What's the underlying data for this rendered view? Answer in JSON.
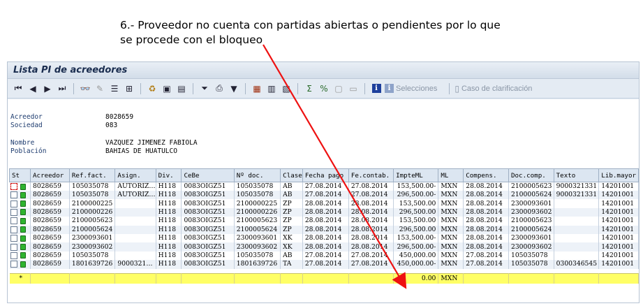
{
  "annotation": {
    "line1": "6.- Proveedor no cuenta con partidas abiertas o pendientes por lo que",
    "line2": "se procede con el bloqueo"
  },
  "window": {
    "title": "Lista PI de acreedores"
  },
  "toolbar": {
    "selecciones_label": "Selecciones",
    "caso_label": "Caso de clarificación",
    "icons": [
      "first-page-icon",
      "prev-page-icon",
      "next-page-icon",
      "last-page-icon",
      "display-icon",
      "change-icon",
      "detail-icon",
      "expand-icon",
      "refresh-icon",
      "overview-icon",
      "document-icon",
      "filter-icon",
      "print-icon",
      "subtotal-icon",
      "layout-icon",
      "select-layout-icon",
      "save-layout-icon",
      "sum-icon",
      "sort-icon",
      "export-icon",
      "mail-icon",
      "info-icon",
      "selections-icon",
      "clarification-icon"
    ]
  },
  "header": {
    "acreedor_label": "Acreedor",
    "acreedor_value": "8028659",
    "sociedad_label": "Sociedad",
    "sociedad_value": "083",
    "nombre_label": "Nombre",
    "nombre_value": "VAZQUEZ JIMENEZ FABIOLA",
    "poblacion_label": "Población",
    "poblacion_value": "BAHIAS DE HUATULCO"
  },
  "table": {
    "columns": [
      "St",
      "Acreedor",
      "Ref.fact.",
      "Asign.",
      "Div.",
      "CeBe",
      "Nº doc.",
      "Clase",
      "Fecha pago",
      "Fe.contab.",
      "ImpteML",
      "ML",
      "Compens.",
      "Doc.comp.",
      "Texto",
      "Lib.mayor"
    ],
    "rows": [
      [
        "",
        "8028659",
        "105035078",
        "AUTORIZ…",
        "H118",
        "0083OIGZ51",
        "105035078",
        "AB",
        "27.08.2014",
        "27.08.2014",
        "153,500.00-",
        "MXN",
        "28.08.2014",
        "2100005623",
        "9000321331",
        "14201001"
      ],
      [
        "",
        "8028659",
        "105035078",
        "AUTORIZ…",
        "H118",
        "0083OIGZ51",
        "105035078",
        "AB",
        "27.08.2014",
        "27.08.2014",
        "296,500.00-",
        "MXN",
        "28.08.2014",
        "2100005624",
        "9000321331",
        "14201001"
      ],
      [
        "",
        "8028659",
        "2100000225",
        "",
        "H118",
        "0083OIGZ51",
        "2100000225",
        "ZP",
        "28.08.2014",
        "28.08.2014",
        "153,500.00",
        "MXN",
        "28.08.2014",
        "2300093601",
        "",
        "14201001"
      ],
      [
        "",
        "8028659",
        "2100000226",
        "",
        "H118",
        "0083OIGZ51",
        "2100000226",
        "ZP",
        "28.08.2014",
        "28.08.2014",
        "296,500.00",
        "MXN",
        "28.08.2014",
        "2300093602",
        "",
        "14201001"
      ],
      [
        "",
        "8028659",
        "2100005623",
        "",
        "H118",
        "0083OIGZ51",
        "2100005623",
        "ZP",
        "28.08.2014",
        "28.08.2014",
        "153,500.00",
        "MXN",
        "28.08.2014",
        "2100005623",
        "",
        "14201001"
      ],
      [
        "",
        "8028659",
        "2100005624",
        "",
        "H118",
        "0083OIGZ51",
        "2100005624",
        "ZP",
        "28.08.2014",
        "28.08.2014",
        "296,500.00",
        "MXN",
        "28.08.2014",
        "2100005624",
        "",
        "14201001"
      ],
      [
        "",
        "8028659",
        "2300093601",
        "",
        "H118",
        "0083OIGZ51",
        "2300093601",
        "XK",
        "28.08.2014",
        "28.08.2014",
        "153,500.00-",
        "MXN",
        "28.08.2014",
        "2300093601",
        "",
        "14201001"
      ],
      [
        "",
        "8028659",
        "2300093602",
        "",
        "H118",
        "0083OIGZ51",
        "2300093602",
        "XK",
        "28.08.2014",
        "28.08.2014",
        "296,500.00-",
        "MXN",
        "28.08.2014",
        "2300093602",
        "",
        "14201001"
      ],
      [
        "",
        "8028659",
        "105035078",
        "",
        "H118",
        "0083OIGZ51",
        "105035078",
        "AB",
        "27.08.2014",
        "27.08.2014",
        "450,000.00",
        "MXN",
        "27.08.2014",
        "105035078",
        "",
        "14201001"
      ],
      [
        "",
        "8028659",
        "1801639726",
        "9000321…",
        "H118",
        "0083OIGZ51",
        "1801639726",
        "TA",
        "27.08.2014",
        "27.08.2014",
        "450,000.00-",
        "MXN",
        "27.08.2014",
        "105035078",
        "0300346545",
        "14201001"
      ]
    ],
    "total": {
      "marker": "*",
      "amount": "0.00",
      "currency": "MXN"
    }
  },
  "colors": {
    "arrow": "#ee1111",
    "total_bg": "#ffff66",
    "led": "#2fb42f"
  }
}
